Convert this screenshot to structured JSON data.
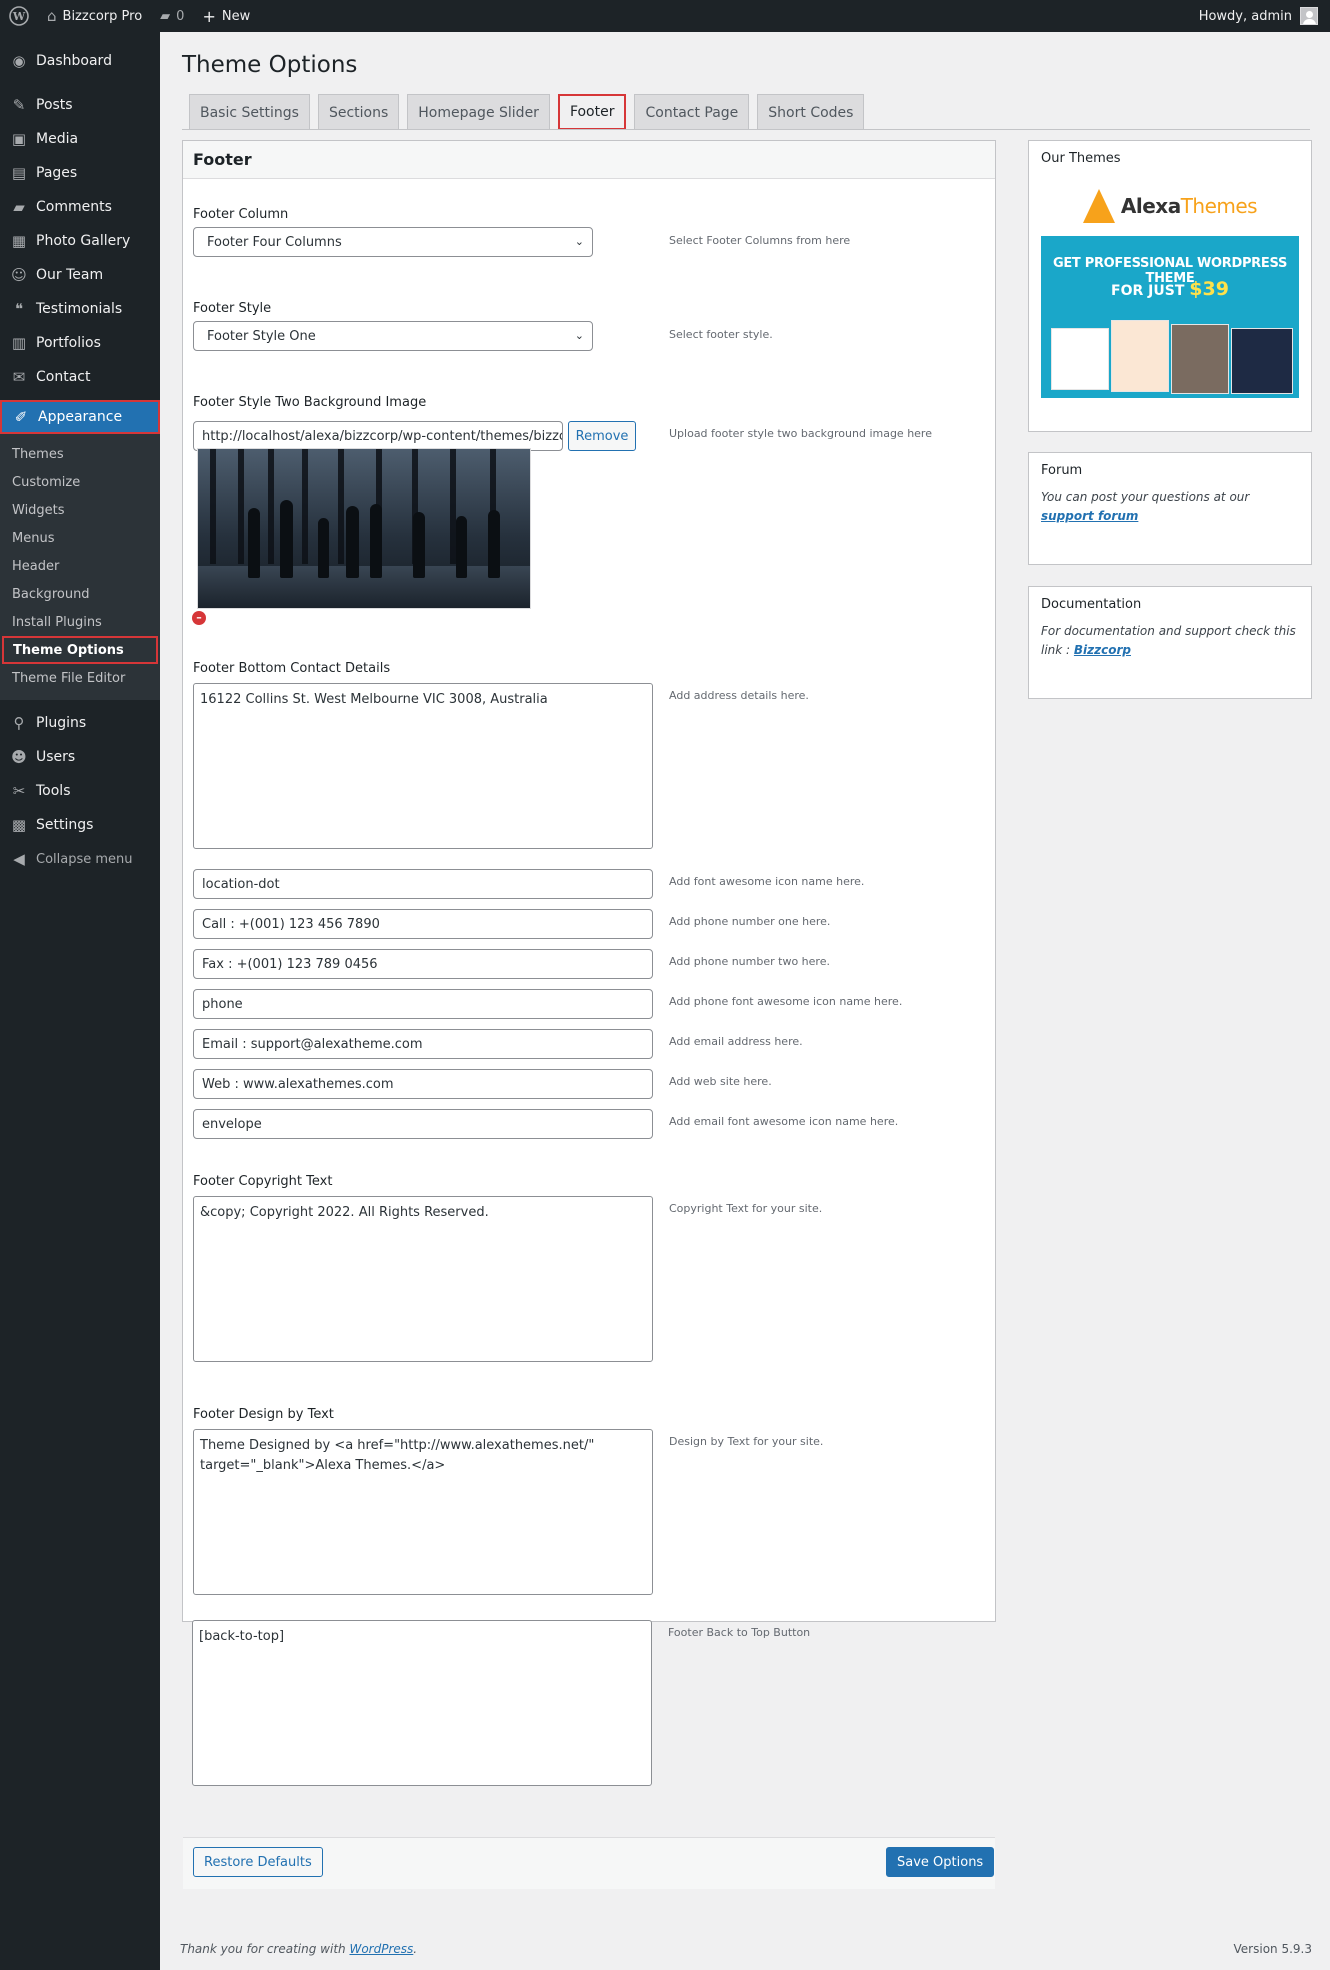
{
  "adminbar": {
    "site_name": "Bizzcorp Pro",
    "comments_count": "0",
    "new_label": "New",
    "howdy": "Howdy, admin"
  },
  "sidebar": {
    "items": [
      {
        "label": "Dashboard",
        "icon": "dashboard-icon"
      },
      {
        "label": "Posts",
        "icon": "pin-icon"
      },
      {
        "label": "Media",
        "icon": "media-icon"
      },
      {
        "label": "Pages",
        "icon": "pages-icon"
      },
      {
        "label": "Comments",
        "icon": "comment-icon"
      },
      {
        "label": "Photo Gallery",
        "icon": "gallery-icon"
      },
      {
        "label": "Our Team",
        "icon": "team-icon"
      },
      {
        "label": "Testimonials",
        "icon": "quote-icon"
      },
      {
        "label": "Portfolios",
        "icon": "portfolio-icon"
      },
      {
        "label": "Contact",
        "icon": "mail-icon"
      },
      {
        "label": "Appearance",
        "icon": "brush-icon"
      }
    ],
    "submenu": [
      "Themes",
      "Customize",
      "Widgets",
      "Menus",
      "Header",
      "Background",
      "Install Plugins",
      "Theme Options",
      "Theme File Editor"
    ],
    "items_after": [
      {
        "label": "Plugins",
        "icon": "plugin-icon"
      },
      {
        "label": "Users",
        "icon": "user-icon"
      },
      {
        "label": "Tools",
        "icon": "wrench-icon"
      },
      {
        "label": "Settings",
        "icon": "settings-icon"
      },
      {
        "label": "Collapse menu",
        "icon": "collapse-icon"
      }
    ]
  },
  "page": {
    "title": "Theme Options",
    "tabs": [
      "Basic Settings",
      "Sections",
      "Homepage Slider",
      "Footer",
      "Contact Page",
      "Short Codes"
    ],
    "active_tab": "Footer"
  },
  "panel": {
    "heading": "Footer",
    "footer_column": {
      "label": "Footer Column",
      "value": "Footer Four Columns",
      "help": "Select Footer Columns from here"
    },
    "footer_style": {
      "label": "Footer Style",
      "value": "Footer Style One",
      "help": "Select footer style."
    },
    "bg_image": {
      "label": "Footer Style Two Background Image",
      "value": "http://localhost/alexa/bizzcorp/wp-content/themes/bizzco",
      "remove": "Remove",
      "help": "Upload footer style two background image here"
    },
    "contact": {
      "label": "Footer Bottom Contact Details",
      "address": "16122 Collins St. West Melbourne VIC 3008, Australia",
      "address_help": "Add address details here."
    },
    "fields": [
      {
        "value": "location-dot",
        "help": "Add font awesome icon name here."
      },
      {
        "value": "Call : +(001) 123 456 7890",
        "help": "Add phone number one here."
      },
      {
        "value": "Fax : +(001) 123 789 0456",
        "help": "Add phone number two here."
      },
      {
        "value": "phone",
        "help": "Add phone font awesome icon name here."
      },
      {
        "value": "Email : support@alexatheme.com",
        "help": "Add email address here."
      },
      {
        "value": "Web : www.alexathemes.com",
        "help": "Add web site here."
      },
      {
        "value": "envelope",
        "help": "Add email font awesome icon name here."
      }
    ],
    "copyright": {
      "label": "Footer Copyright Text",
      "value": "&copy; Copyright 2022. All Rights Reserved.",
      "help": "Copyright Text for your site."
    },
    "design_by": {
      "label": "Footer Design by Text",
      "value": "Theme Designed by <a href=\"http://www.alexathemes.net/\" target=\"_blank\">Alexa Themes.</a>",
      "help": "Design by Text for your site."
    },
    "back_to_top": {
      "value": "[back-to-top]",
      "help": "Footer Back to Top Button"
    },
    "restore": "Restore Defaults",
    "save": "Save Options"
  },
  "widgets": {
    "themes": {
      "title": "Our Themes",
      "logo_a": "Alexa",
      "logo_b": "Themes",
      "promo_line1": "GET PROFESSIONAL WORDPRESS THEME",
      "promo_line2": "FOR JUST",
      "promo_price": "$39"
    },
    "forum": {
      "title": "Forum",
      "text": "You can post your questions at our ",
      "link": "support forum"
    },
    "docs": {
      "title": "Documentation",
      "text": "For documentation and support check this link : ",
      "link": "Bizzcorp"
    }
  },
  "footer": {
    "thanks": "Thank you for creating with ",
    "wp_link": "WordPress",
    "thanks_end": ".",
    "version": "Version 5.9.3"
  },
  "colors": {
    "accent": "#2271b1",
    "highlight": "#d63638",
    "sidebar": "#1d2327"
  }
}
